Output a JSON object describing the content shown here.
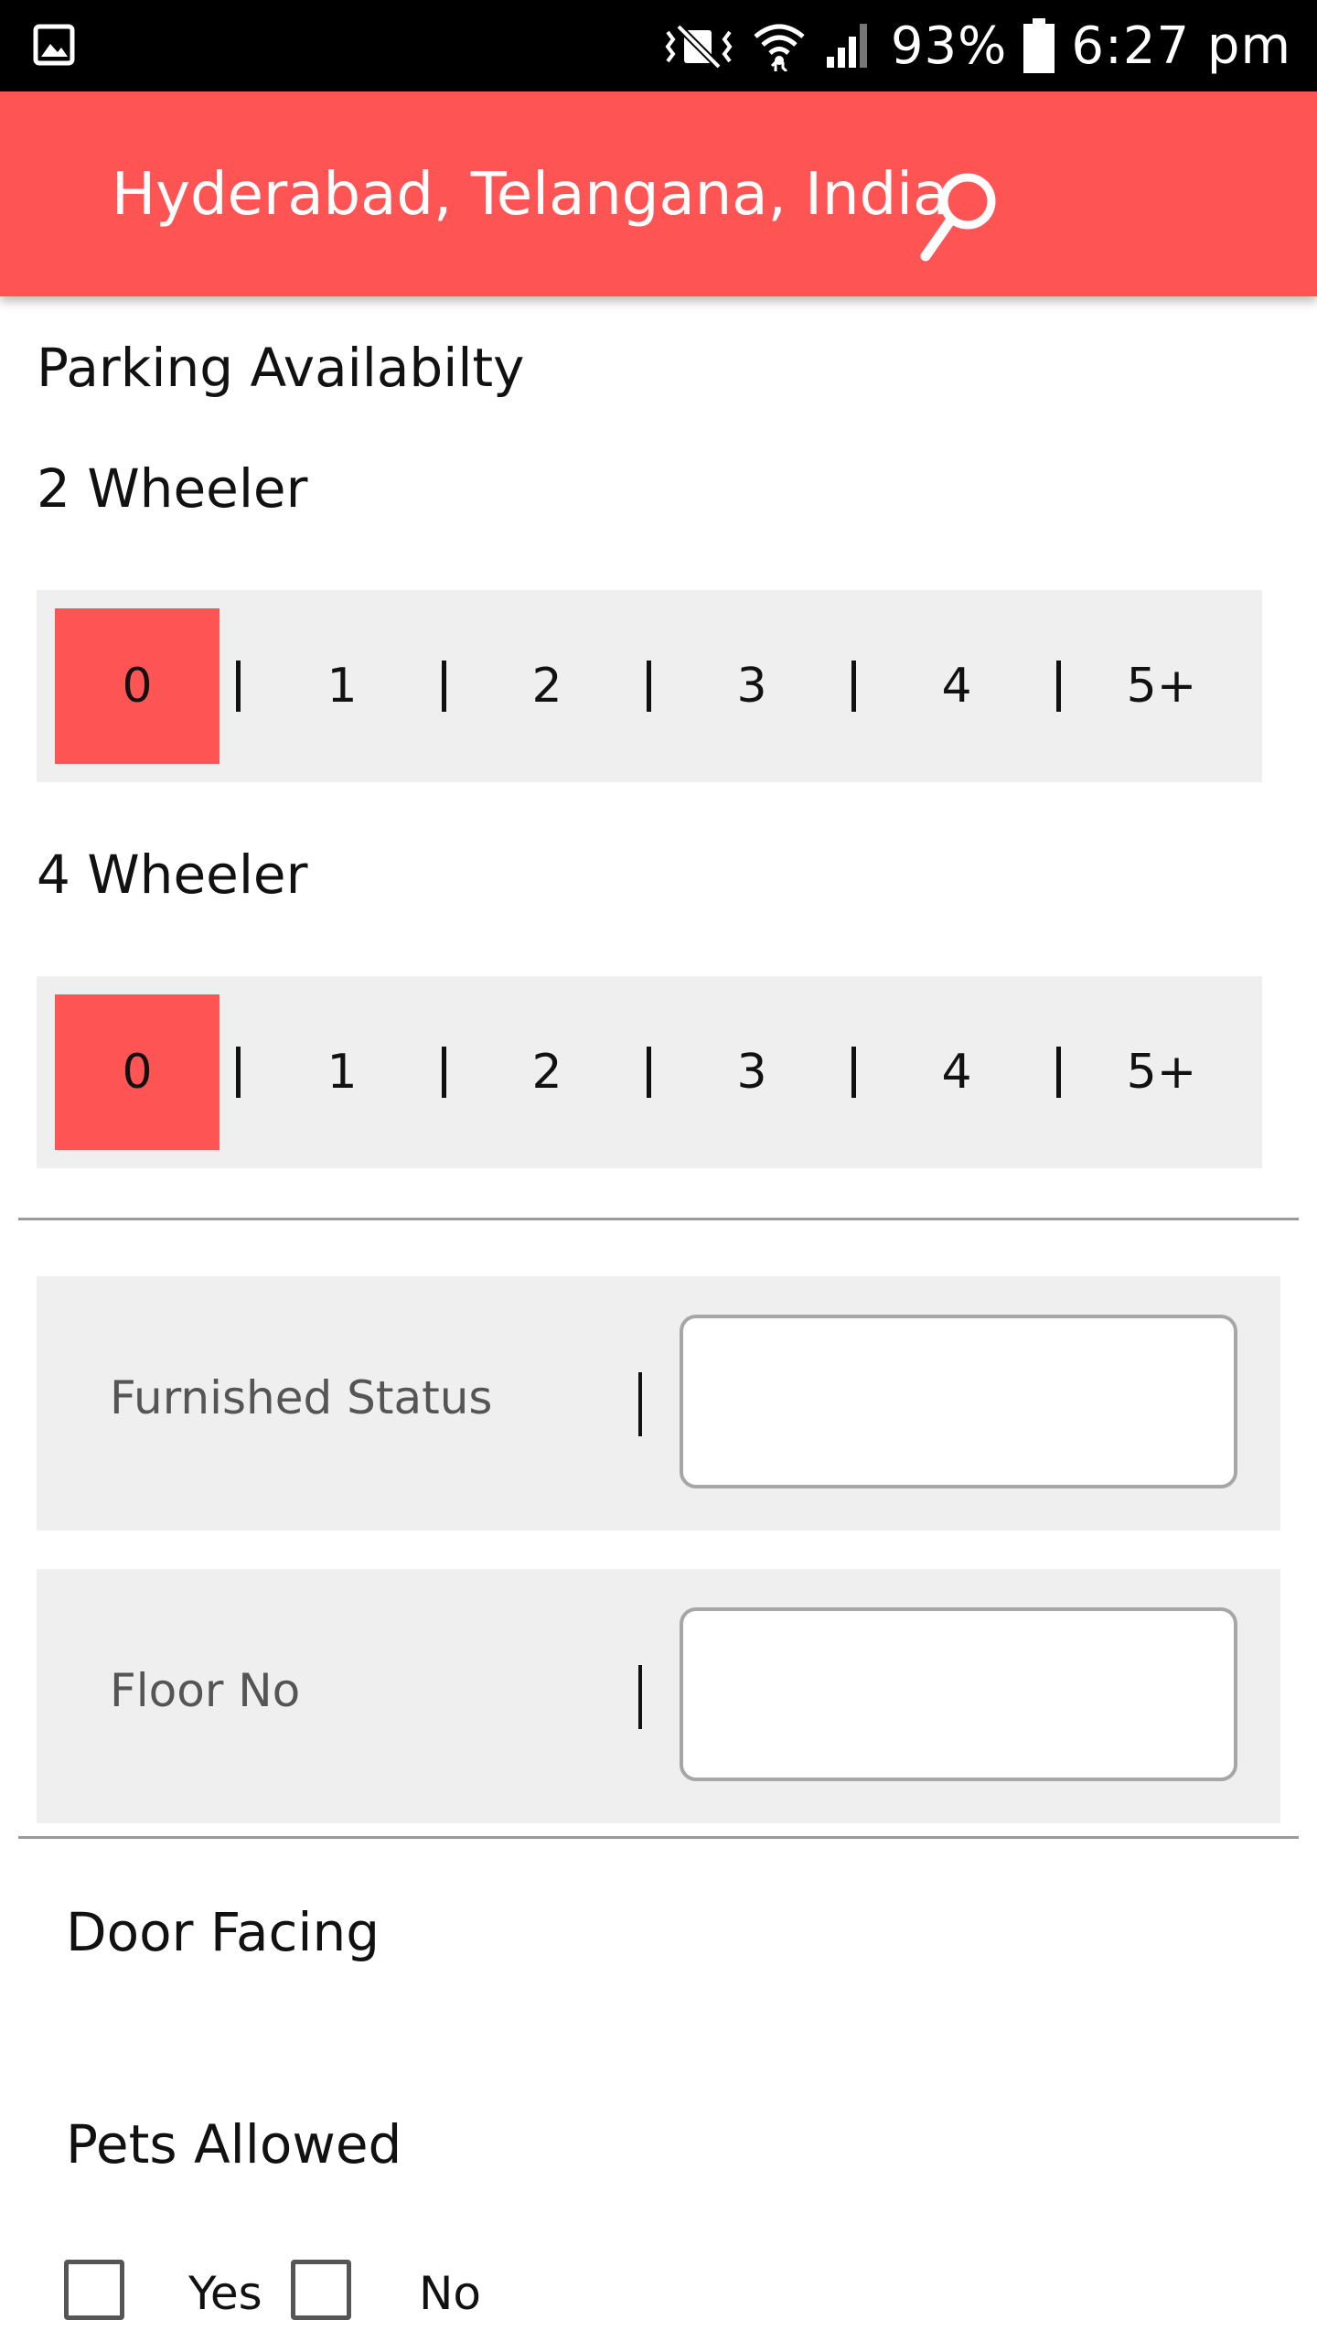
{
  "status_bar": {
    "battery_percent": "93%",
    "time": "6:27 pm",
    "icons": [
      "gallery-icon",
      "vibrate-mute-icon",
      "wifi-icon",
      "signal-icon",
      "battery-icon"
    ]
  },
  "app_bar": {
    "location": "Hyderabad, Telangana, India",
    "icon": "search-icon",
    "color": "#ff5454"
  },
  "parking": {
    "title": "Parking Availabilty",
    "two_wheeler": {
      "label": "2 Wheeler",
      "options": [
        "0",
        "1",
        "2",
        "3",
        "4",
        "5+"
      ],
      "selected": "0"
    },
    "four_wheeler": {
      "label": "4 Wheeler",
      "options": [
        "0",
        "1",
        "2",
        "3",
        "4",
        "5+"
      ],
      "selected": "0"
    }
  },
  "fields": {
    "furnished_status": {
      "label": "Furnished Status",
      "value": ""
    },
    "floor_no": {
      "label": "Floor No",
      "value": ""
    }
  },
  "door_facing": {
    "title": "Door Facing"
  },
  "pets_allowed": {
    "title": "Pets Allowed",
    "yes_label": "Yes",
    "no_label": "No",
    "yes_checked": false,
    "no_checked": false
  },
  "colors": {
    "accent": "#ff5454",
    "panel": "#efefef",
    "divider": "#9a9a9a"
  }
}
